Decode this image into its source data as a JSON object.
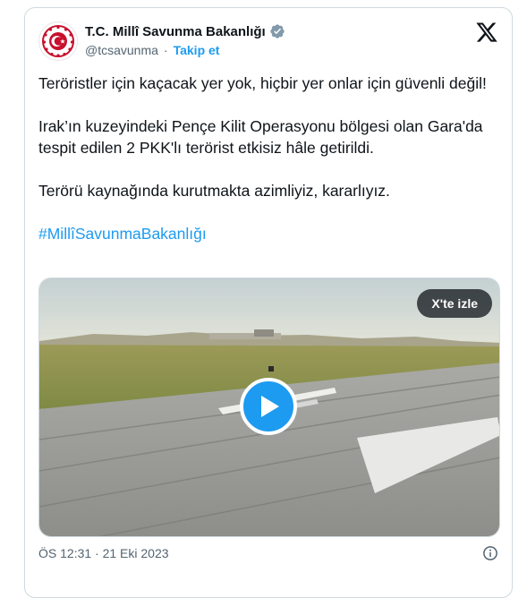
{
  "author": {
    "display_name": "T.C. Millî Savunma Bakanlığı",
    "handle": "@tcsavunma",
    "follow_label": "Takip et",
    "verified_color": "#829aab",
    "avatar_emblem_color": "#c8102e"
  },
  "tweet": {
    "paragraph1": "Teröristler için kaçacak yer yok, hiçbir yer onlar için güvenli değil!",
    "paragraph2": "Irak’ın kuzeyindeki Pençe Kilit Operasyonu bölgesi olan Gara'da tespit edilen 2 PKK'lı terörist etkisiz hâle getirildi.",
    "paragraph3": "Terörü kaynağında kurutmakta azimliyiz, kararlıyız.",
    "hashtag": "#MillîSavunmaBakanlığı"
  },
  "media": {
    "watch_label": "X'te izle",
    "accent": "#1d9bf0"
  },
  "footer": {
    "timestamp": "ÖS 12:31 · 21 Eki 2023"
  },
  "icons": {
    "brand": "x-logo-icon",
    "verified": "verified-badge-icon",
    "play": "play-icon",
    "info": "info-icon"
  }
}
